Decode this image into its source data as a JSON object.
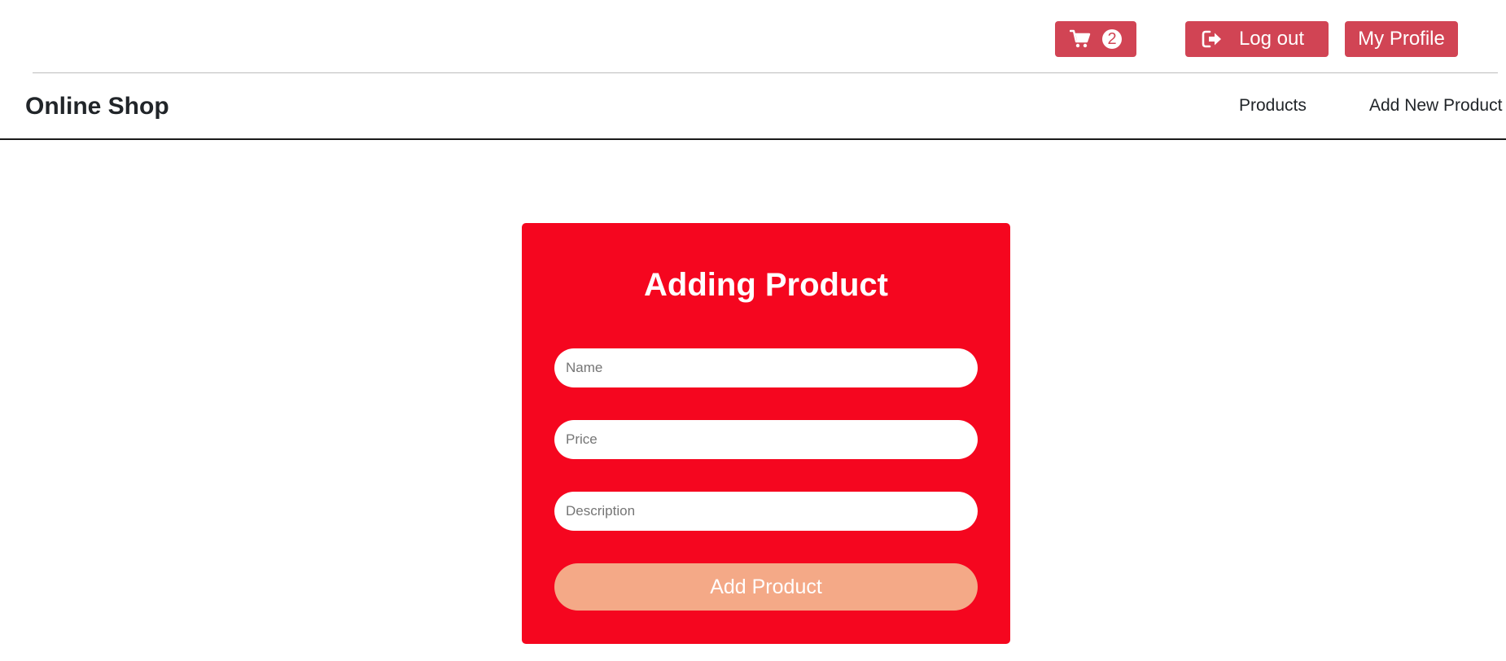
{
  "header": {
    "cart": {
      "icon": "shopping-cart-icon",
      "count": "2"
    },
    "logout": {
      "icon": "sign-out-icon",
      "label": "Log out"
    },
    "profile": {
      "label": "My Profile"
    }
  },
  "navbar": {
    "brand": "Online Shop",
    "links": [
      {
        "label": "Products"
      },
      {
        "label": "Add New Product"
      }
    ]
  },
  "form": {
    "title": "Adding Product",
    "fields": {
      "name": {
        "placeholder": "Name",
        "value": ""
      },
      "price": {
        "placeholder": "Price",
        "value": ""
      },
      "description": {
        "placeholder": "Description",
        "value": ""
      }
    },
    "submit_label": "Add Product"
  },
  "colors": {
    "header_button": "#d14454",
    "card_background": "#f5061f",
    "submit_button": "#f4a987"
  }
}
